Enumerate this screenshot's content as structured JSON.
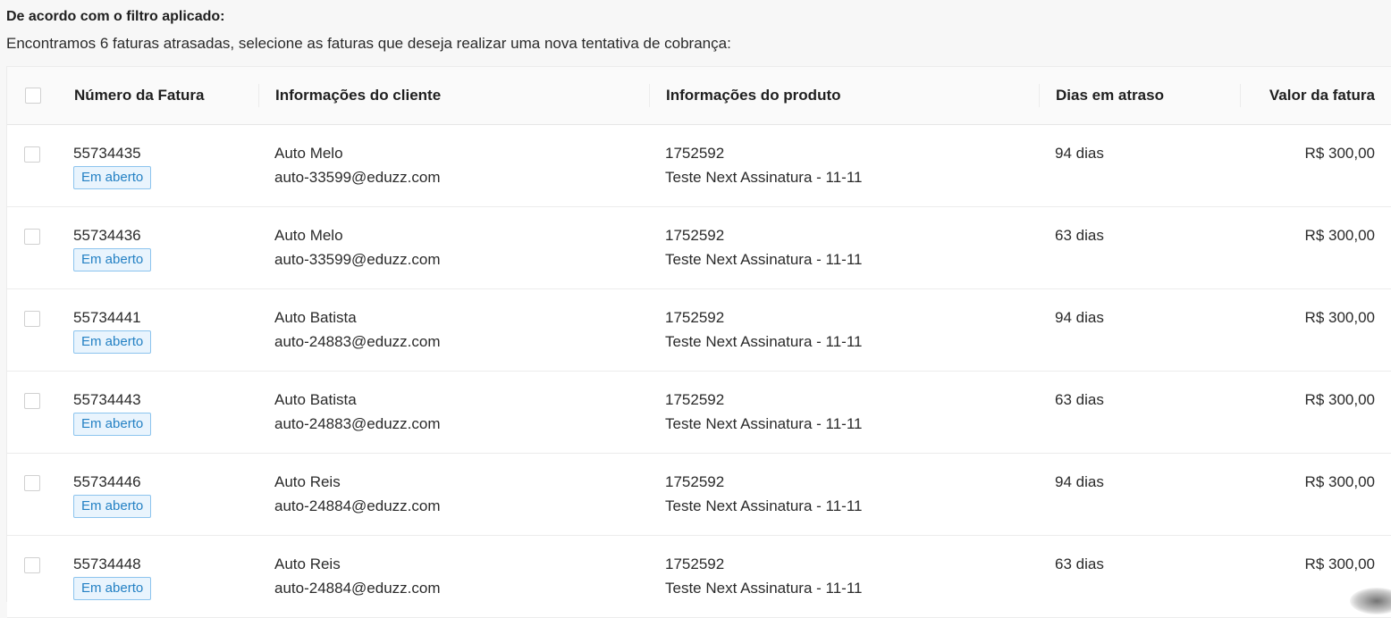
{
  "header": {
    "title": "De acordo com o filtro aplicado:",
    "description": "Encontramos 6 faturas atrasadas, selecione as faturas que deseja realizar uma nova tentativa de cobrança:"
  },
  "table": {
    "columns": {
      "invoice": "Número da Fatura",
      "client": "Informações do cliente",
      "product": "Informações do produto",
      "days": "Dias em atraso",
      "value": "Valor da fatura"
    },
    "rows": [
      {
        "invoice": "55734435",
        "status": "Em aberto",
        "client_name": "Auto Melo",
        "client_email": "auto-33599@eduzz.com",
        "product_id": "1752592",
        "product_name": "Teste Next Assinatura - 11-11",
        "days": "94 dias",
        "value": "R$ 300,00"
      },
      {
        "invoice": "55734436",
        "status": "Em aberto",
        "client_name": "Auto Melo",
        "client_email": "auto-33599@eduzz.com",
        "product_id": "1752592",
        "product_name": "Teste Next Assinatura - 11-11",
        "days": "63 dias",
        "value": "R$ 300,00"
      },
      {
        "invoice": "55734441",
        "status": "Em aberto",
        "client_name": "Auto Batista",
        "client_email": "auto-24883@eduzz.com",
        "product_id": "1752592",
        "product_name": "Teste Next Assinatura - 11-11",
        "days": "94 dias",
        "value": "R$ 300,00"
      },
      {
        "invoice": "55734443",
        "status": "Em aberto",
        "client_name": "Auto Batista",
        "client_email": "auto-24883@eduzz.com",
        "product_id": "1752592",
        "product_name": "Teste Next Assinatura - 11-11",
        "days": "63 dias",
        "value": "R$ 300,00"
      },
      {
        "invoice": "55734446",
        "status": "Em aberto",
        "client_name": "Auto Reis",
        "client_email": "auto-24884@eduzz.com",
        "product_id": "1752592",
        "product_name": "Teste Next Assinatura - 11-11",
        "days": "94 dias",
        "value": "R$ 300,00"
      },
      {
        "invoice": "55734448",
        "status": "Em aberto",
        "client_name": "Auto Reis",
        "client_email": "auto-24884@eduzz.com",
        "product_id": "1752592",
        "product_name": "Teste Next Assinatura - 11-11",
        "days": "63 dias",
        "value": "R$ 300,00"
      }
    ]
  },
  "colors": {
    "badge_border": "#8cc4ee",
    "badge_bg": "#e9f4fd",
    "badge_text": "#2481c4"
  }
}
